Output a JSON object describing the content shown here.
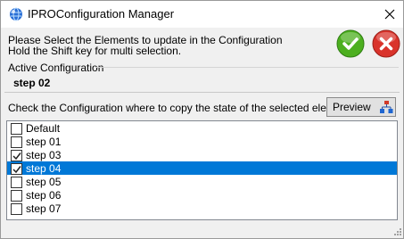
{
  "window": {
    "title": "IPROConfiguration Manager",
    "icon": "app-globe-icon",
    "close_icon": "close-icon"
  },
  "instructions": {
    "line1": "Please Select the Elements to update in the Configuration",
    "line2": "Hold the Shift key for multi selection."
  },
  "actions": {
    "ok_icon": "checkmark-icon",
    "ok_color": "#4caf1f",
    "cancel_icon": "cancel-x-icon",
    "cancel_color": "#d9332b"
  },
  "active_configuration": {
    "label": "Active Configuration",
    "value": "step 02"
  },
  "copy_section": {
    "label": "Check the Configuration where to copy the state of the selected elements",
    "preview_label": "Preview",
    "preview_icon": "hierarchy-icon"
  },
  "configurations": [
    {
      "label": "Default",
      "checked": false,
      "selected": false
    },
    {
      "label": "step 01",
      "checked": false,
      "selected": false
    },
    {
      "label": "step 03",
      "checked": true,
      "selected": false
    },
    {
      "label": "step 04",
      "checked": true,
      "selected": true
    },
    {
      "label": "step 05",
      "checked": false,
      "selected": false
    },
    {
      "label": "step 06",
      "checked": false,
      "selected": false
    },
    {
      "label": "step 07",
      "checked": false,
      "selected": false
    }
  ],
  "colors": {
    "selection": "#0078d7"
  }
}
